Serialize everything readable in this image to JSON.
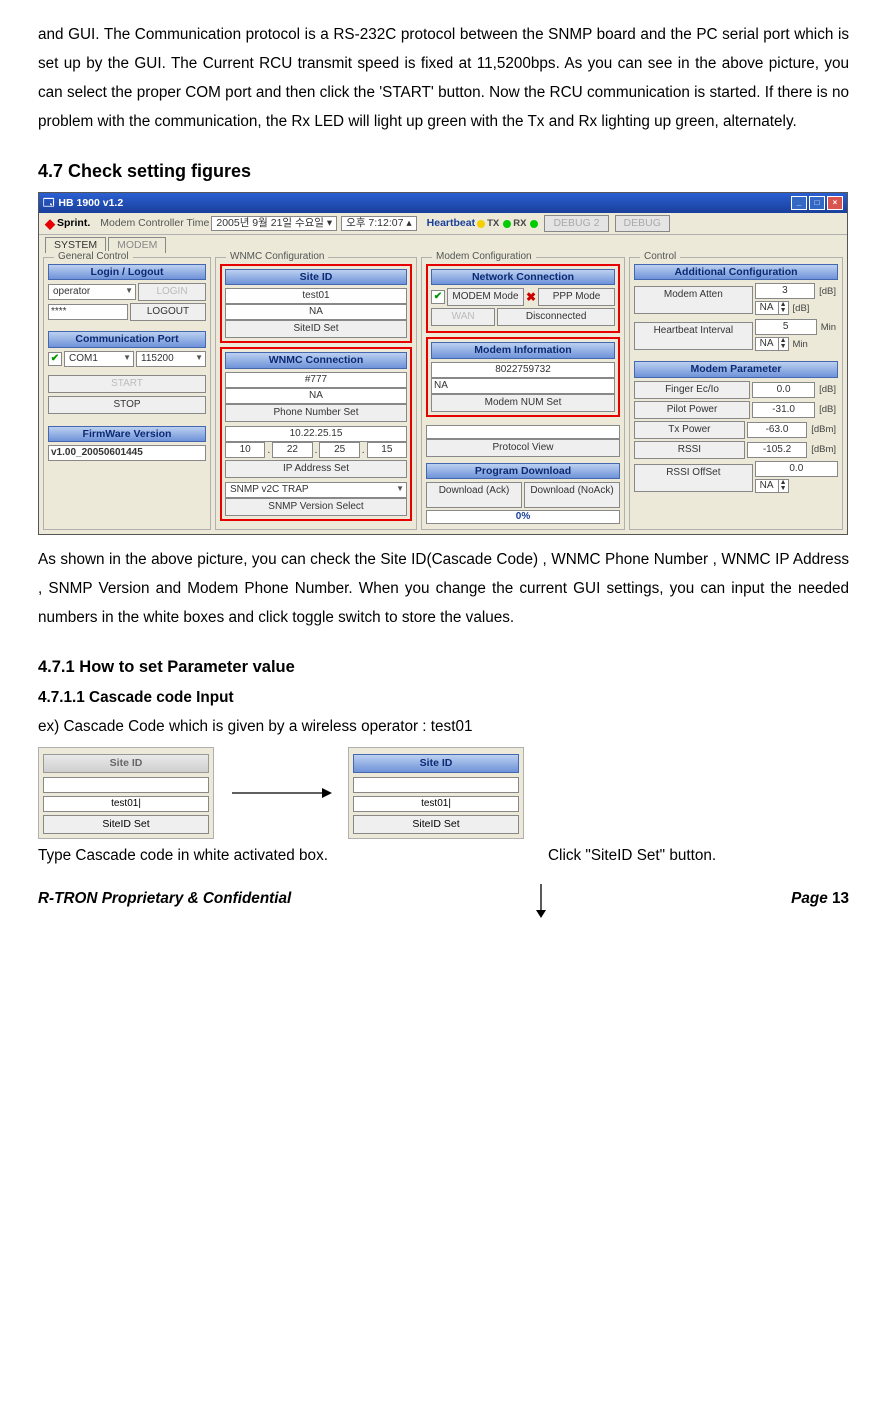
{
  "intro_paragraph": "and GUI. The Communication protocol is a RS-232C protocol between the SNMP board and the PC serial port which is set up by the GUI. The Current RCU transmit speed is fixed at 11,5200bps. As you can see in the above picture, you can select the proper COM port and then click the 'START' button. Now the RCU communication is started. If there is no problem with the communication, the Rx LED will light up green with the Tx and Rx lighting up green, alternately.",
  "h47": "4.7 Check setting figures",
  "window": {
    "title": "HB 1900 v1.2",
    "brand": "Sprint.",
    "ctl_label": "Modem Controller Time",
    "date": "2005년   9월 21일 수요일",
    "time": "오후   7:12:07",
    "heartbeat": "Heartbeat",
    "tx": "TX",
    "rx": "RX",
    "debug2": "DEBUG 2",
    "debug": "DEBUG",
    "tab_system": "SYSTEM",
    "tab_modem": "MODEM",
    "groups": {
      "general": "General Control",
      "wnmc": "WNMC Configuration",
      "modemcfg": "Modem Configuration",
      "control": "Control"
    },
    "login": {
      "header": "Login / Logout",
      "role": "operator",
      "pwd": "****",
      "login_btn": "LOGIN",
      "logout_btn": "LOGOUT"
    },
    "comport": {
      "header": "Communication Port",
      "port": "COM1",
      "baud": "115200",
      "start": "START",
      "stop": "STOP"
    },
    "fw": {
      "header": "FirmWare Version",
      "value": "v1.00_20050601445"
    },
    "siteid": {
      "header": "Site ID",
      "val": "test01",
      "edit": "NA",
      "set": "SiteID Set"
    },
    "wnmc_conn": {
      "header": "WNMC Connection",
      "phone": "#777",
      "phone_edit": "NA",
      "phone_set": "Phone Number Set",
      "ip_disp": "10.22.25.15",
      "ip_oct1": "10",
      "ip_oct2": "22",
      "ip_oct3": "25",
      "ip_oct4": "15",
      "ip_set": "IP Address Set",
      "snmp_sel": "SNMP v2C TRAP",
      "snmp_set": "SNMP Version Select"
    },
    "netconn": {
      "header": "Network Connection",
      "modem_mode": "MODEM Mode",
      "ppp_mode": "PPP Mode",
      "wan": "WAN",
      "disconnected": "Disconnected"
    },
    "modeminfo": {
      "header": "Modem Information",
      "num": "8022759732",
      "edit": "NA",
      "set": "Modem NUM Set",
      "proto": "Protocol View"
    },
    "progdl": {
      "header": "Program Download",
      "ack": "Download (Ack)",
      "noack": "Download (NoAck)",
      "pct": "0%"
    },
    "addcfg": {
      "header": "Additional Configuration",
      "atten": "Modem Atten",
      "atten_v": "3",
      "atten_e": "NA",
      "u_db": "[dB]",
      "hb": "Heartbeat Interval",
      "hb_v": "5",
      "hb_e": "NA",
      "u_min": "Min"
    },
    "modparam": {
      "header": "Modem Parameter",
      "finger": "Finger Ec/Io",
      "finger_v": "0.0",
      "pilot": "Pilot Power",
      "pilot_v": "-31.0",
      "txp": "Tx Power",
      "txp_v": "-63.0",
      "rssi": "RSSI",
      "rssi_v": "-105.2",
      "rssio": "RSSI OffSet",
      "rssio_v": "0.0",
      "rssio_e": "NA",
      "u_db": "[dB]",
      "u_dbm": "[dBm]"
    }
  },
  "after_fig": "As shown in the above picture, you can check the Site ID(Cascade Code) , WNMC Phone Number , WNMC IP Address , SNMP Version and Modem Phone Number. When you change the current GUI settings, you can input the needed numbers in the white boxes and click toggle switch to store the values.",
  "h471": "4.7.1    How to set Parameter value",
  "h4711": "4.7.1.1 Cascade code Input",
  "ex_line": "ex) Cascade Code which is given by a wireless operator : test01",
  "site_a": {
    "hdr": "Site ID",
    "blank": "",
    "val": "test01|",
    "set": "SiteID Set"
  },
  "site_b": {
    "hdr": "Site ID",
    "blank": "",
    "val": "test01|",
    "set": "SiteID Set"
  },
  "cap_left": "Type Cascade code in white activated box.",
  "cap_right": "Click \"SiteID Set\" button.",
  "footer_left": "R-TRON Proprietary & Confidential",
  "footer_right": "Page 13"
}
